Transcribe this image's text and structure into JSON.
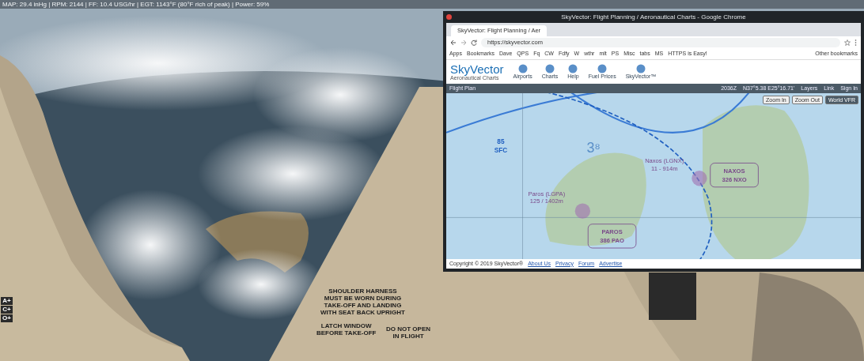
{
  "status_bar": {
    "text": "MAP: 29.4 inHg | RPM: 2144 | FF: 10.4 USG/hr | EGT: 1143°F (80°F rich of peak) | Power: 59%"
  },
  "side_buttons": [
    "A+",
    "C+",
    "O+"
  ],
  "placards": [
    {
      "lines": [
        "SHOULDER HARNESS",
        "MUST BE WORN DURING",
        "TAKE-OFF AND LANDING",
        "WITH SEAT BACK UPRIGHT"
      ]
    },
    {
      "lines": [
        "LATCH WINDOW",
        "BEFORE TAKE-OFF"
      ]
    },
    {
      "lines": [
        "DO NOT OPEN",
        "IN FLIGHT"
      ]
    }
  ],
  "browser": {
    "title": "SkyVector: Flight Planning / Aeronautical Charts - Google Chrome",
    "tabs": [
      {
        "label": "SkyVector: Flight Planning / Aer",
        "selected": true
      }
    ],
    "url": "https://skyvector.com",
    "bookmarks": [
      {
        "label": "Apps"
      },
      {
        "label": "Bookmarks"
      },
      {
        "label": "Dave"
      },
      {
        "label": "QPS"
      },
      {
        "label": "Fq"
      },
      {
        "label": "CW"
      },
      {
        "label": "Fdfy"
      },
      {
        "label": "W"
      },
      {
        "label": "wthr"
      },
      {
        "label": "mlt"
      },
      {
        "label": "PS"
      },
      {
        "label": "Misc"
      },
      {
        "label": "tabs"
      },
      {
        "label": "MS"
      },
      {
        "label": "HTTPS is Easy!"
      },
      {
        "label": "Other bookmarks"
      }
    ],
    "site": {
      "logo": "SkyVector",
      "tagline": "Aeronautical Charts",
      "nav": [
        {
          "label": "Airports"
        },
        {
          "label": "Charts"
        },
        {
          "label": "Help"
        },
        {
          "label": "Fuel Prices"
        },
        {
          "label": "SkyVector™"
        }
      ],
      "toolbar": {
        "flight_plan": "Flight Plan",
        "time": "2036Z",
        "coords": "N37°5.38 E25°16.71'",
        "items": [
          "Layers",
          "Link",
          "Sign In"
        ]
      },
      "map_buttons": [
        {
          "label": "Zoom In"
        },
        {
          "label": "Zoom Out"
        },
        {
          "label": "World VFR"
        }
      ],
      "map_labels": {
        "airspace": [
          "85",
          "SFC"
        ],
        "grid": "3⁸",
        "naxos": [
          "Naxos (LGNX)",
          "11 - 914m"
        ],
        "naxos_vor": [
          "NAXOS",
          "326 NXO"
        ],
        "paros": [
          "Paros (LGPA)",
          "125 / 1402m"
        ],
        "paros_vor": [
          "PAROS",
          "386 PAO"
        ]
      },
      "copyright": "Copyright © 2019 SkyVector®",
      "footer_links": [
        "About Us",
        "Privacy",
        "Forum",
        "Advertise"
      ]
    }
  }
}
